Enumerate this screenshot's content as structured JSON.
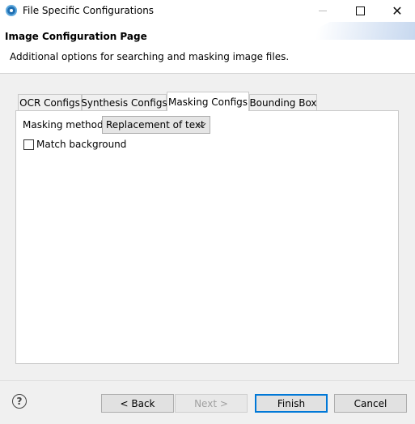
{
  "window": {
    "title": "File Specific Configurations",
    "close_glyph": "✕"
  },
  "header": {
    "title": "Image Configuration Page",
    "description": "Additional options for searching and masking image files."
  },
  "tabs": [
    {
      "label": "OCR Configs",
      "active": false
    },
    {
      "label": "Synthesis Configs",
      "active": false
    },
    {
      "label": "Masking Configs",
      "active": true
    },
    {
      "label": "Bounding Box",
      "active": false
    }
  ],
  "masking": {
    "method_label": "Masking method:",
    "method_value": "Replacement of text",
    "match_background_label": "Match background",
    "match_background_checked": false
  },
  "footer": {
    "help_glyph": "?",
    "back_label": "< Back",
    "next_label": "Next >",
    "finish_label": "Finish",
    "cancel_label": "Cancel"
  },
  "colors": {
    "accent": "#0078d7",
    "app_icon": "#1f6fb2"
  }
}
